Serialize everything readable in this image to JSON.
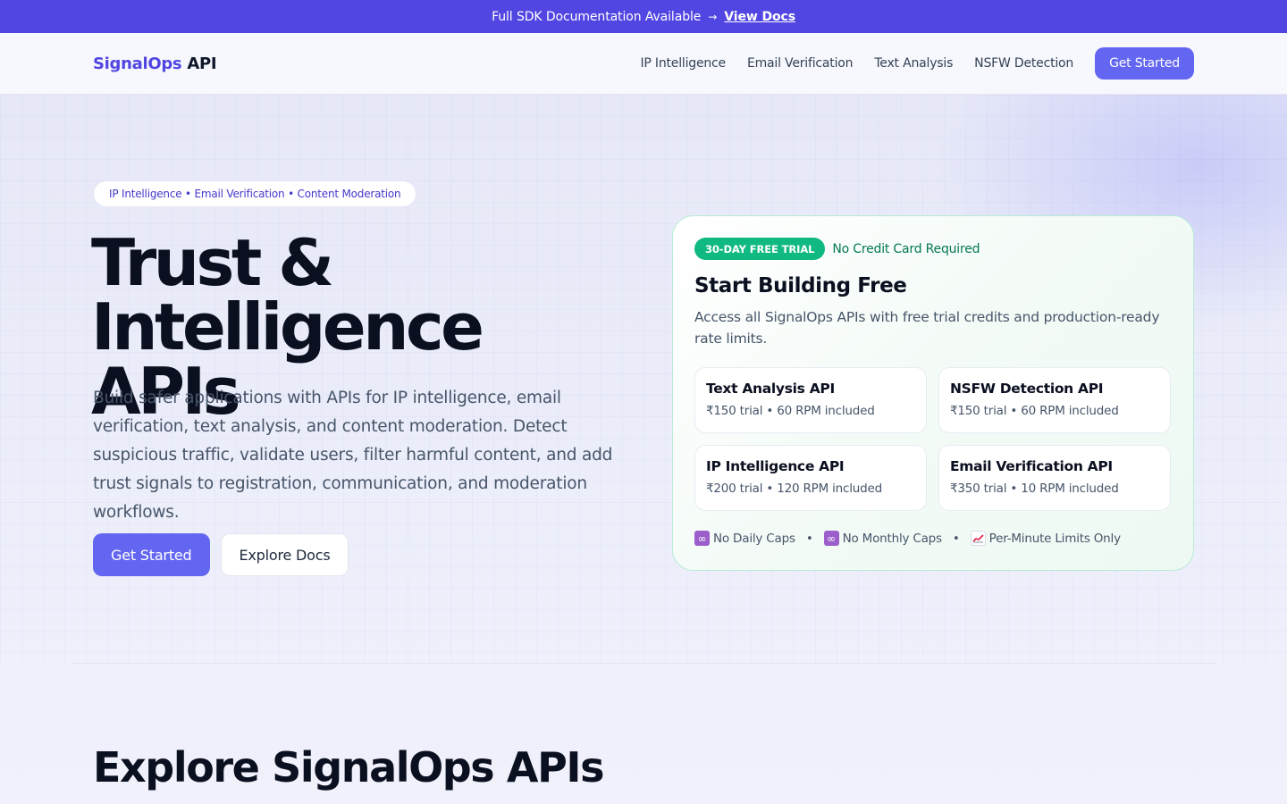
{
  "announcement": {
    "text": "Full SDK Documentation Available",
    "arrow": "→",
    "link_label": "View Docs"
  },
  "header": {
    "logo_brand": "SignalOps",
    "logo_suffix": "API",
    "nav": [
      {
        "label": "IP Intelligence"
      },
      {
        "label": "Email Verification"
      },
      {
        "label": "Text Analysis"
      },
      {
        "label": "NSFW Detection"
      }
    ],
    "cta_label": "Get Started"
  },
  "hero": {
    "pill": "IP Intelligence • Email Verification • Content Moderation",
    "title_line1": "Trust &",
    "title_line2": "Intelligence APIs",
    "description": "Build safer applications with APIs for IP intelligence, email verification, text analysis, and content moderation. Detect suspicious traffic, validate users, filter harmful content, and add trust signals to registration, communication, and moderation workflows.",
    "primary_button": "Get Started",
    "secondary_button": "Explore Docs"
  },
  "trial_card": {
    "badge": "30-DAY FREE TRIAL",
    "no_card": "No Credit Card Required",
    "title": "Start Building Free",
    "description": "Access all SignalOps APIs with free trial credits and production-ready rate limits.",
    "apis": [
      {
        "name": "Text Analysis API",
        "meta": "₹150 trial • 60 RPM included"
      },
      {
        "name": "NSFW Detection API",
        "meta": "₹150 trial • 60 RPM included"
      },
      {
        "name": "IP Intelligence API",
        "meta": "₹200 trial • 120 RPM included"
      },
      {
        "name": "Email Verification API",
        "meta": "₹350 trial • 10 RPM included"
      }
    ],
    "limits": [
      {
        "icon": "infinity-icon",
        "label": "No Daily Caps"
      },
      {
        "icon": "infinity-icon",
        "label": "No Monthly Caps"
      },
      {
        "icon": "chart-up-icon",
        "label": "Per-Minute Limits Only"
      }
    ],
    "separator": "•"
  },
  "explore": {
    "title": "Explore SignalOps APIs"
  },
  "colors": {
    "accent": "#5146e1",
    "button": "#6366f1",
    "success": "#10b981"
  }
}
